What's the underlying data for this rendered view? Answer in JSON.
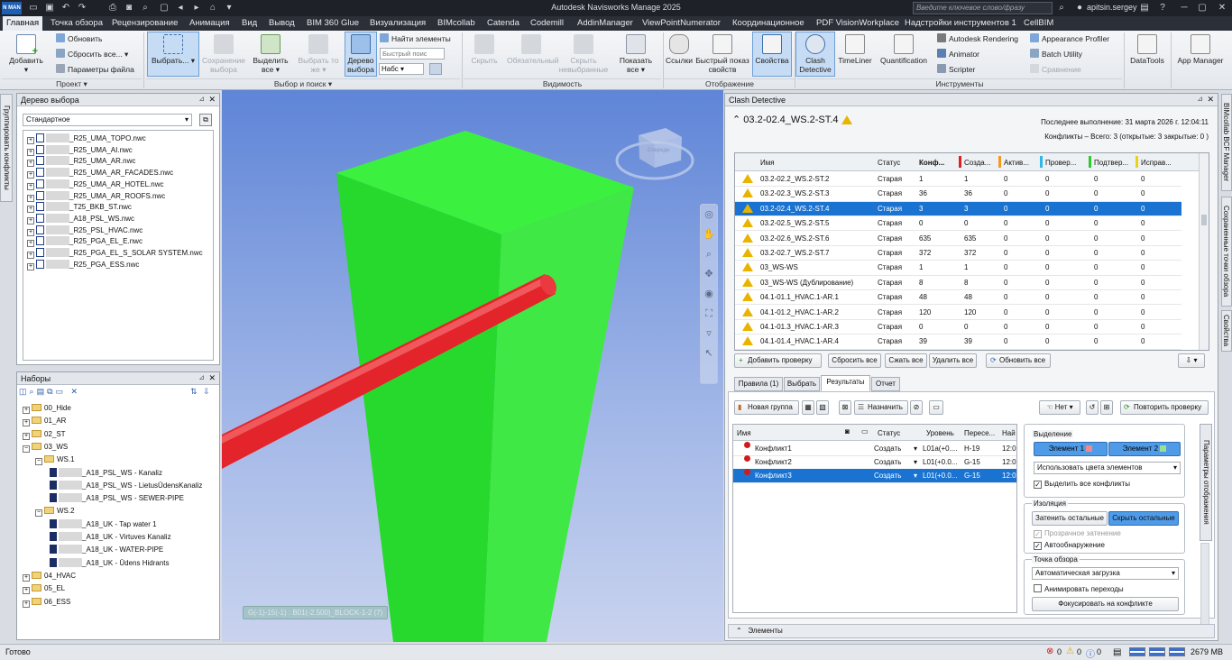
{
  "app": {
    "title": "Autodesk Navisworks Manage 2025",
    "logo": "N MAN",
    "search_placeholder": "Введите ключевое слово/фразу",
    "user": "apitsin.sergey"
  },
  "menu": [
    "Главная",
    "Точка обзора",
    "Рецензирование",
    "Анимация",
    "Вид",
    "Вывод",
    "BIM 360 Glue",
    "Визуализация",
    "BIMcollab",
    "Catenda",
    "Codemill",
    "AddinManager",
    "ViewPointNumerator",
    "Координационное",
    "PDF VisionWorkplace",
    "Надстройки инструментов 1",
    "CellBIM"
  ],
  "ribbon": {
    "add": "Добавить",
    "refresh": "Обновить",
    "reset_all": "Сбросить все...",
    "file_params": "Параметры файла",
    "select": "Выбрать...",
    "save_selection": "Сохранение выбора",
    "select_all": "Выделить все",
    "select_same": "Выбрать то же",
    "selection_tree": "Дерево выбора",
    "find_items": "Найти элементы",
    "quick_find_placeholder": "Быстрый поис",
    "sets": "Набс",
    "hide": "Скрыть",
    "required": "Обязательный",
    "hide_unselected": "Скрыть невыбранные",
    "show_all": "Показать все",
    "links": "Ссылки",
    "quick_props": "Быстрый показ свойств",
    "properties": "Свойства",
    "clash_detective": "Clash Detective",
    "timeliner": "TimeLiner",
    "quantification": "Quantification",
    "rendering": "Autodesk Rendering",
    "animator": "Animator",
    "scripter": "Scripter",
    "appearance_profiler": "Appearance Profiler",
    "batch_utility": "Batch Utility",
    "compare": "Сравнение",
    "datatools": "DataTools",
    "app_manager": "App Manager",
    "groups": [
      "Проект",
      "Выбор и поиск",
      "Видимость",
      "Отображение",
      "Инструменты"
    ]
  },
  "selection_tree": {
    "title": "Дерево выбора",
    "mode": "Стандартное",
    "items": [
      "_R25_UMA_TOPO.nwc",
      "_R25_UMA_AI.nwc",
      "_R25_UMA_AR.nwc",
      "_R25_UMA_AR_FACADES.nwc",
      "_R25_UMA_AR_HOTEL.nwc",
      "_R25_UMA_AR_ROOFS.nwc",
      "_T25_BKB_ST.nwc",
      "_A18_PSL_WS.nwc",
      "_R25_PSL_HVAC.nwc",
      "_R25_PGA_EL_E.nwc",
      "_R25_PGA_EL_S_SOLAR SYSTEM.nwc",
      "_R25_PGA_ESS.nwc"
    ]
  },
  "sets": {
    "title": "Наборы",
    "items": [
      {
        "label": "00_Hide",
        "level": 0,
        "folder": true
      },
      {
        "label": "01_AR",
        "level": 0,
        "folder": true
      },
      {
        "label": "02_ST",
        "level": 0,
        "folder": true
      },
      {
        "label": "03_WS",
        "level": 0,
        "folder": true
      },
      {
        "label": "WS.1",
        "level": 1,
        "folder": true
      },
      {
        "label": "_A18_PSL_WS - Kanaliz",
        "level": 2,
        "folder": false
      },
      {
        "label": "_A18_PSL_WS - LietusŪdensKanaliz",
        "level": 2,
        "folder": false
      },
      {
        "label": "_A18_PSL_WS - SEWER-PIPE",
        "level": 2,
        "folder": false
      },
      {
        "label": "WS.2",
        "level": 1,
        "folder": true
      },
      {
        "label": "_A18_UK - Tap water 1",
        "level": 2,
        "folder": false
      },
      {
        "label": "_A18_UK - Virtuves Kanaliz",
        "level": 2,
        "folder": false
      },
      {
        "label": "_A18_UK - WATER-PIPE",
        "level": 2,
        "folder": false
      },
      {
        "label": "_A18_UK - Ūdens Hidrants",
        "level": 2,
        "folder": false
      },
      {
        "label": "04_HVAC",
        "level": 0,
        "folder": true
      },
      {
        "label": "05_EL",
        "level": 0,
        "folder": true
      },
      {
        "label": "06_ESS",
        "level": 0,
        "folder": true
      }
    ]
  },
  "left_tab": "Группировать конфликты",
  "viewport": {
    "label": "G(-1)-15(-1) : B01(-2.500)_BLOCK-1-2 (7)",
    "cube_face": "Спереди",
    "colors": {
      "column": "#35e03a",
      "pipe": "#e8262b"
    }
  },
  "clash": {
    "panel_title": "Clash Detective",
    "test_name": "03.2-02.4_WS.2-ST.4",
    "last_run_label": "Последнее выполнение:",
    "last_run": "31 марта 2026 г. 12:04:11",
    "summary": "Конфликты – Всего: 3  (открытые: 3  закрытые: 0 )",
    "columns": [
      "Имя",
      "Статус",
      "Конф...",
      "Созда...",
      "Актив...",
      "Провер...",
      "Подтвер...",
      "Исправ..."
    ],
    "column_colors": [
      "#e02020",
      "#f39a1c",
      "#2fb7e8",
      "#2ec92e",
      "#e8d21a"
    ],
    "tests": [
      {
        "name": "03.2-02.2_WS.2-ST.2",
        "status": "Старая",
        "clashes": "1",
        "new": "1",
        "active": "0",
        "reviewed": "0",
        "approved": "0",
        "resolved": "0"
      },
      {
        "name": "03.2-02.3_WS.2-ST.3",
        "status": "Старая",
        "clashes": "36",
        "new": "36",
        "active": "0",
        "reviewed": "0",
        "approved": "0",
        "resolved": "0"
      },
      {
        "name": "03.2-02.4_WS.2-ST.4",
        "status": "Старая",
        "clashes": "3",
        "new": "3",
        "active": "0",
        "reviewed": "0",
        "approved": "0",
        "resolved": "0",
        "selected": true
      },
      {
        "name": "03.2-02.5_WS.2-ST.5",
        "status": "Старая",
        "clashes": "0",
        "new": "0",
        "active": "0",
        "reviewed": "0",
        "approved": "0",
        "resolved": "0"
      },
      {
        "name": "03.2-02.6_WS.2-ST.6",
        "status": "Старая",
        "clashes": "635",
        "new": "635",
        "active": "0",
        "reviewed": "0",
        "approved": "0",
        "resolved": "0"
      },
      {
        "name": "03.2-02.7_WS.2-ST.7",
        "status": "Старая",
        "clashes": "372",
        "new": "372",
        "active": "0",
        "reviewed": "0",
        "approved": "0",
        "resolved": "0"
      },
      {
        "name": "03_WS-WS",
        "status": "Старая",
        "clashes": "1",
        "new": "1",
        "active": "0",
        "reviewed": "0",
        "approved": "0",
        "resolved": "0"
      },
      {
        "name": "03_WS-WS (Дублирование)",
        "status": "Старая",
        "clashes": "8",
        "new": "8",
        "active": "0",
        "reviewed": "0",
        "approved": "0",
        "resolved": "0"
      },
      {
        "name": "04.1-01.1_HVAC.1-AR.1",
        "status": "Старая",
        "clashes": "48",
        "new": "48",
        "active": "0",
        "reviewed": "0",
        "approved": "0",
        "resolved": "0"
      },
      {
        "name": "04.1-01.2_HVAC.1-AR.2",
        "status": "Старая",
        "clashes": "120",
        "new": "120",
        "active": "0",
        "reviewed": "0",
        "approved": "0",
        "resolved": "0"
      },
      {
        "name": "04.1-01.3_HVAC.1-AR.3",
        "status": "Старая",
        "clashes": "0",
        "new": "0",
        "active": "0",
        "reviewed": "0",
        "approved": "0",
        "resolved": "0"
      },
      {
        "name": "04.1-01.4_HVAC.1-AR.4",
        "status": "Старая",
        "clashes": "39",
        "new": "39",
        "active": "0",
        "reviewed": "0",
        "approved": "0",
        "resolved": "0"
      }
    ],
    "buttons": {
      "add_test": "Добавить проверку",
      "reset_all": "Сбросить все",
      "compact_all": "Сжать все",
      "delete_all": "Удалить все",
      "update_all": "Обновить все"
    },
    "tabs": [
      "Правила (1)",
      "Выбрать",
      "Результаты",
      "Отчет"
    ],
    "active_tab": "Результаты",
    "results_toolbar": {
      "new_group": "Новая группа",
      "assign": "Назначить",
      "none": "Нет",
      "rerun": "Повторить проверку"
    },
    "results_columns": [
      "Имя",
      "Статус",
      "Уровень",
      "Пересе...",
      "Най"
    ],
    "results": [
      {
        "name": "Конфликт1",
        "status": "Создать",
        "level": "L01a(+0....",
        "grid": "H-19",
        "found": "12:0"
      },
      {
        "name": "Конфликт2",
        "status": "Создать",
        "level": "L01(+0.0...",
        "grid": "G-15",
        "found": "12:0"
      },
      {
        "name": "Конфликт3",
        "status": "Создать",
        "level": "L01(+0.0...",
        "grid": "G-15",
        "found": "12:0",
        "selected": true
      }
    ],
    "highlight": {
      "title": "Выделение",
      "item1": "Элемент 1",
      "item2": "Элемент 2",
      "item1_color": "#f08a8a",
      "item2_color": "#9be08e",
      "mode": "Использовать цвета элементов",
      "all_clashes": "Выделить все конфликты"
    },
    "isolation": {
      "title": "Изоляция",
      "dim_others": "Затенить остальные",
      "hide_others": "Скрыть остальные",
      "transparent_dim": "Прозрачное затенение",
      "auto_reveal": "Автообнаружение"
    },
    "viewpoint": {
      "title": "Точка обзора",
      "mode": "Автоматическая загрузка",
      "animate": "Анимировать переходы",
      "focus": "Фокусировать на конфликте"
    },
    "display_settings_tab": "Параметры отображения",
    "elements_section": "Элементы"
  },
  "right_tabs": [
    "BIMcollab BCF Manager",
    "Сохраненные точки обзора",
    "Свойства"
  ],
  "status": {
    "ready": "Готово",
    "errors": "0",
    "warnings": "0",
    "info": "0",
    "memory": "2679 MB"
  }
}
